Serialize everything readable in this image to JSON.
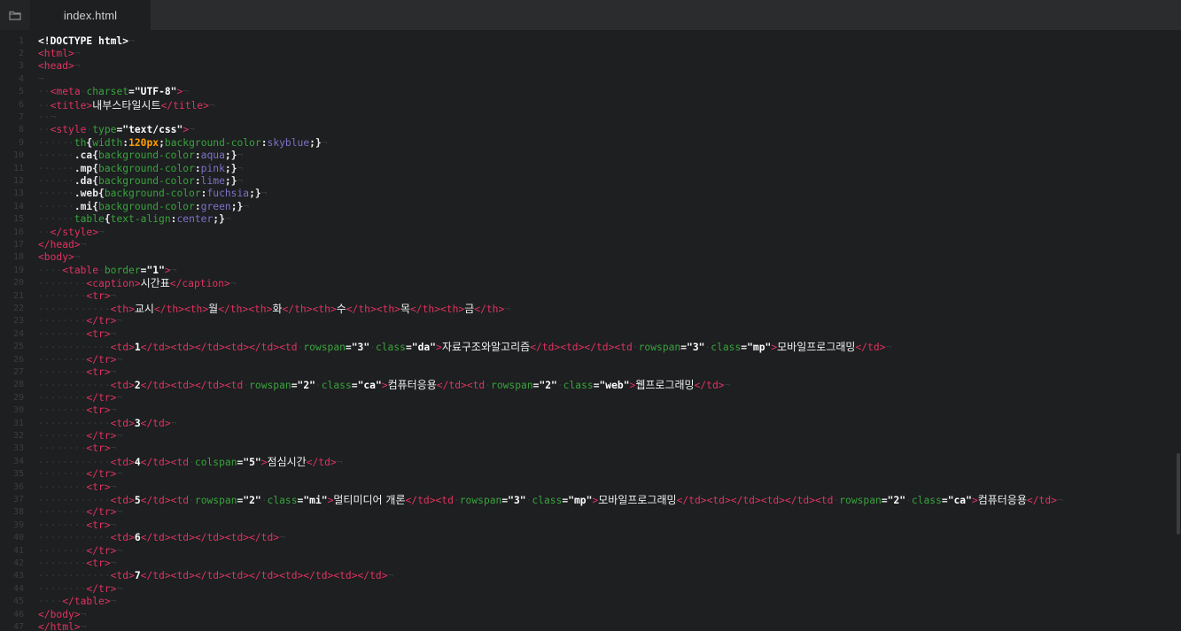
{
  "sidebar": {
    "toggle_icon": "folder-icon"
  },
  "tab": {
    "label": "index.html"
  },
  "lines": [
    {
      "n": "1",
      "segs": [
        [
          "d",
          "<!DOCTYPE html>"
        ],
        [
          "w",
          "¬"
        ]
      ]
    },
    {
      "n": "2",
      "segs": [
        [
          "t",
          "<html>"
        ],
        [
          "w",
          "¬"
        ]
      ]
    },
    {
      "n": "3",
      "segs": [
        [
          "t",
          "<head>"
        ],
        [
          "w",
          "¬"
        ]
      ]
    },
    {
      "n": "4",
      "segs": [
        [
          "w",
          "¬"
        ]
      ]
    },
    {
      "n": "5",
      "segs": [
        [
          "w",
          "··"
        ],
        [
          "t",
          "<meta"
        ],
        [
          "w",
          "·"
        ],
        [
          "a",
          "charset"
        ],
        [
          "p",
          "="
        ],
        [
          "s",
          "\"UTF-8\""
        ],
        [
          "t",
          ">"
        ],
        [
          "w",
          "¬"
        ]
      ]
    },
    {
      "n": "6",
      "segs": [
        [
          "w",
          "··"
        ],
        [
          "t",
          "<title>"
        ],
        [
          "k",
          "내부스타일시트"
        ],
        [
          "t",
          "</title>"
        ],
        [
          "w",
          "¬"
        ]
      ]
    },
    {
      "n": "7",
      "segs": [
        [
          "w",
          "··¬"
        ]
      ]
    },
    {
      "n": "8",
      "segs": [
        [
          "w",
          "··"
        ],
        [
          "t",
          "<style"
        ],
        [
          "w",
          "·"
        ],
        [
          "a",
          "type"
        ],
        [
          "p",
          "="
        ],
        [
          "s",
          "\"text/css\""
        ],
        [
          "t",
          ">"
        ],
        [
          "w",
          "¬"
        ]
      ]
    },
    {
      "n": "9",
      "segs": [
        [
          "w",
          "······"
        ],
        [
          "a",
          "th"
        ],
        [
          "p",
          "{"
        ],
        [
          "a",
          "width"
        ],
        [
          "p",
          ":"
        ],
        [
          "n",
          "120px"
        ],
        [
          "p",
          ";"
        ],
        [
          "a",
          "background-color"
        ],
        [
          "p",
          ":"
        ],
        [
          "v",
          "skyblue"
        ],
        [
          "p",
          ";}"
        ],
        [
          "w",
          "¬"
        ]
      ]
    },
    {
      "n": "10",
      "segs": [
        [
          "w",
          "······"
        ],
        [
          "p",
          ".ca{"
        ],
        [
          "a",
          "background-color"
        ],
        [
          "p",
          ":"
        ],
        [
          "v",
          "aqua"
        ],
        [
          "p",
          ";}"
        ],
        [
          "w",
          "¬"
        ]
      ]
    },
    {
      "n": "11",
      "segs": [
        [
          "w",
          "······"
        ],
        [
          "p",
          ".mp{"
        ],
        [
          "a",
          "background-color"
        ],
        [
          "p",
          ":"
        ],
        [
          "v",
          "pink"
        ],
        [
          "p",
          ";}"
        ],
        [
          "w",
          "¬"
        ]
      ]
    },
    {
      "n": "12",
      "segs": [
        [
          "w",
          "······"
        ],
        [
          "p",
          ".da{"
        ],
        [
          "a",
          "background-color"
        ],
        [
          "p",
          ":"
        ],
        [
          "v",
          "lime"
        ],
        [
          "p",
          ";}"
        ],
        [
          "w",
          "¬"
        ]
      ]
    },
    {
      "n": "13",
      "segs": [
        [
          "w",
          "······"
        ],
        [
          "p",
          ".web{"
        ],
        [
          "a",
          "background-color"
        ],
        [
          "p",
          ":"
        ],
        [
          "v",
          "fuchsia"
        ],
        [
          "p",
          ";}"
        ],
        [
          "w",
          "¬"
        ]
      ]
    },
    {
      "n": "14",
      "segs": [
        [
          "w",
          "······"
        ],
        [
          "p",
          ".mi{"
        ],
        [
          "a",
          "background-color"
        ],
        [
          "p",
          ":"
        ],
        [
          "v",
          "green"
        ],
        [
          "p",
          ";}"
        ],
        [
          "w",
          "¬"
        ]
      ]
    },
    {
      "n": "15",
      "segs": [
        [
          "w",
          "······"
        ],
        [
          "a",
          "table"
        ],
        [
          "p",
          "{"
        ],
        [
          "a",
          "text-align"
        ],
        [
          "p",
          ":"
        ],
        [
          "v",
          "center"
        ],
        [
          "p",
          ";}"
        ],
        [
          "w",
          "¬"
        ]
      ]
    },
    {
      "n": "16",
      "segs": [
        [
          "w",
          "··"
        ],
        [
          "t",
          "</style>"
        ],
        [
          "w",
          "¬"
        ]
      ]
    },
    {
      "n": "17",
      "segs": [
        [
          "t",
          "</head>"
        ],
        [
          "w",
          "¬"
        ]
      ]
    },
    {
      "n": "18",
      "segs": [
        [
          "t",
          "<body>"
        ],
        [
          "w",
          "¬"
        ]
      ]
    },
    {
      "n": "19",
      "segs": [
        [
          "w",
          "····"
        ],
        [
          "t",
          "<table"
        ],
        [
          "w",
          "·"
        ],
        [
          "a",
          "border"
        ],
        [
          "p",
          "="
        ],
        [
          "s",
          "\"1\""
        ],
        [
          "t",
          ">"
        ],
        [
          "w",
          "¬"
        ]
      ]
    },
    {
      "n": "20",
      "segs": [
        [
          "w",
          "········"
        ],
        [
          "t",
          "<caption>"
        ],
        [
          "k",
          "시간표"
        ],
        [
          "t",
          "</caption>"
        ],
        [
          "w",
          "¬"
        ]
      ]
    },
    {
      "n": "21",
      "segs": [
        [
          "w",
          "········"
        ],
        [
          "t",
          "<tr>"
        ],
        [
          "w",
          "¬"
        ]
      ]
    },
    {
      "n": "22",
      "segs": [
        [
          "w",
          "············"
        ],
        [
          "t",
          "<th>"
        ],
        [
          "k",
          "교시"
        ],
        [
          "t",
          "</th><th>"
        ],
        [
          "k",
          "월"
        ],
        [
          "t",
          "</th><th>"
        ],
        [
          "k",
          "화"
        ],
        [
          "t",
          "</th><th>"
        ],
        [
          "k",
          "수"
        ],
        [
          "t",
          "</th><th>"
        ],
        [
          "k",
          "목"
        ],
        [
          "t",
          "</th><th>"
        ],
        [
          "k",
          "금"
        ],
        [
          "t",
          "</th>"
        ],
        [
          "w",
          "¬"
        ]
      ]
    },
    {
      "n": "23",
      "segs": [
        [
          "w",
          "········"
        ],
        [
          "t",
          "</tr>"
        ],
        [
          "w",
          "¬"
        ]
      ]
    },
    {
      "n": "24",
      "segs": [
        [
          "w",
          "········"
        ],
        [
          "t",
          "<tr>"
        ],
        [
          "w",
          "¬"
        ]
      ]
    },
    {
      "n": "25",
      "segs": [
        [
          "w",
          "············"
        ],
        [
          "t",
          "<td>"
        ],
        [
          "d",
          "1"
        ],
        [
          "t",
          "</td><td></td><td></td><td"
        ],
        [
          "w",
          "·"
        ],
        [
          "a",
          "rowspan"
        ],
        [
          "p",
          "="
        ],
        [
          "s",
          "\"3\""
        ],
        [
          "w",
          "·"
        ],
        [
          "a",
          "class"
        ],
        [
          "p",
          "="
        ],
        [
          "s",
          "\"da\""
        ],
        [
          "t",
          ">"
        ],
        [
          "k",
          "자료구조와알고리즘"
        ],
        [
          "t",
          "</td><td></td><td"
        ],
        [
          "w",
          "·"
        ],
        [
          "a",
          "rowspan"
        ],
        [
          "p",
          "="
        ],
        [
          "s",
          "\"3\""
        ],
        [
          "w",
          "·"
        ],
        [
          "a",
          "class"
        ],
        [
          "p",
          "="
        ],
        [
          "s",
          "\"mp\""
        ],
        [
          "t",
          ">"
        ],
        [
          "k",
          "모바일프로그래밍"
        ],
        [
          "t",
          "</td>"
        ],
        [
          "w",
          "¬"
        ]
      ]
    },
    {
      "n": "26",
      "segs": [
        [
          "w",
          "········"
        ],
        [
          "t",
          "</tr>"
        ],
        [
          "w",
          "¬"
        ]
      ]
    },
    {
      "n": "27",
      "segs": [
        [
          "w",
          "········"
        ],
        [
          "t",
          "<tr>"
        ],
        [
          "w",
          "¬"
        ]
      ]
    },
    {
      "n": "28",
      "segs": [
        [
          "w",
          "············"
        ],
        [
          "t",
          "<td>"
        ],
        [
          "d",
          "2"
        ],
        [
          "t",
          "</td><td></td><td"
        ],
        [
          "w",
          "·"
        ],
        [
          "a",
          "rowspan"
        ],
        [
          "p",
          "="
        ],
        [
          "s",
          "\"2\""
        ],
        [
          "w",
          "·"
        ],
        [
          "a",
          "class"
        ],
        [
          "p",
          "="
        ],
        [
          "s",
          "\"ca\""
        ],
        [
          "t",
          ">"
        ],
        [
          "k",
          "컴퓨터응용"
        ],
        [
          "t",
          "</td><td"
        ],
        [
          "w",
          "·"
        ],
        [
          "a",
          "rowspan"
        ],
        [
          "p",
          "="
        ],
        [
          "s",
          "\"2\""
        ],
        [
          "w",
          "·"
        ],
        [
          "a",
          "class"
        ],
        [
          "p",
          "="
        ],
        [
          "s",
          "\"web\""
        ],
        [
          "t",
          ">"
        ],
        [
          "k",
          "웹프로그래밍"
        ],
        [
          "t",
          "</td>"
        ],
        [
          "w",
          "¬"
        ]
      ]
    },
    {
      "n": "29",
      "segs": [
        [
          "w",
          "········"
        ],
        [
          "t",
          "</tr>"
        ],
        [
          "w",
          "¬"
        ]
      ]
    },
    {
      "n": "30",
      "segs": [
        [
          "w",
          "········"
        ],
        [
          "t",
          "<tr>"
        ],
        [
          "w",
          "¬"
        ]
      ]
    },
    {
      "n": "31",
      "segs": [
        [
          "w",
          "············"
        ],
        [
          "t",
          "<td>"
        ],
        [
          "d",
          "3"
        ],
        [
          "t",
          "</td>"
        ],
        [
          "w",
          "¬"
        ]
      ]
    },
    {
      "n": "32",
      "segs": [
        [
          "w",
          "········"
        ],
        [
          "t",
          "</tr>"
        ],
        [
          "w",
          "¬"
        ]
      ]
    },
    {
      "n": "33",
      "segs": [
        [
          "w",
          "········"
        ],
        [
          "t",
          "<tr>"
        ],
        [
          "w",
          "¬"
        ]
      ]
    },
    {
      "n": "34",
      "segs": [
        [
          "w",
          "············"
        ],
        [
          "t",
          "<td>"
        ],
        [
          "d",
          "4"
        ],
        [
          "t",
          "</td><td"
        ],
        [
          "w",
          "·"
        ],
        [
          "a",
          "colspan"
        ],
        [
          "p",
          "="
        ],
        [
          "s",
          "\"5\""
        ],
        [
          "t",
          ">"
        ],
        [
          "k",
          "점심시간"
        ],
        [
          "t",
          "</td>"
        ],
        [
          "w",
          "¬"
        ]
      ]
    },
    {
      "n": "35",
      "segs": [
        [
          "w",
          "········"
        ],
        [
          "t",
          "</tr>"
        ],
        [
          "w",
          "¬"
        ]
      ]
    },
    {
      "n": "36",
      "segs": [
        [
          "w",
          "········"
        ],
        [
          "t",
          "<tr>"
        ],
        [
          "w",
          "¬"
        ]
      ]
    },
    {
      "n": "37",
      "segs": [
        [
          "w",
          "············"
        ],
        [
          "t",
          "<td>"
        ],
        [
          "d",
          "5"
        ],
        [
          "t",
          "</td><td"
        ],
        [
          "w",
          "·"
        ],
        [
          "a",
          "rowspan"
        ],
        [
          "p",
          "="
        ],
        [
          "s",
          "\"2\""
        ],
        [
          "w",
          "·"
        ],
        [
          "a",
          "class"
        ],
        [
          "p",
          "="
        ],
        [
          "s",
          "\"mi\""
        ],
        [
          "t",
          ">"
        ],
        [
          "k",
          "멀티미디어 개론"
        ],
        [
          "t",
          "</td><td"
        ],
        [
          "w",
          "·"
        ],
        [
          "a",
          "rowspan"
        ],
        [
          "p",
          "="
        ],
        [
          "s",
          "\"3\""
        ],
        [
          "w",
          "·"
        ],
        [
          "a",
          "class"
        ],
        [
          "p",
          "="
        ],
        [
          "s",
          "\"mp\""
        ],
        [
          "t",
          ">"
        ],
        [
          "k",
          "모바일프로그래밍"
        ],
        [
          "t",
          "</td><td></td><td></td><td"
        ],
        [
          "w",
          "·"
        ],
        [
          "a",
          "rowspan"
        ],
        [
          "p",
          "="
        ],
        [
          "s",
          "\"2\""
        ],
        [
          "w",
          "·"
        ],
        [
          "a",
          "class"
        ],
        [
          "p",
          "="
        ],
        [
          "s",
          "\"ca\""
        ],
        [
          "t",
          ">"
        ],
        [
          "k",
          "컴퓨터응용"
        ],
        [
          "t",
          "</td>"
        ],
        [
          "w",
          "¬"
        ]
      ]
    },
    {
      "n": "38",
      "segs": [
        [
          "w",
          "········"
        ],
        [
          "t",
          "</tr>"
        ],
        [
          "w",
          "¬"
        ]
      ]
    },
    {
      "n": "39",
      "segs": [
        [
          "w",
          "········"
        ],
        [
          "t",
          "<tr>"
        ],
        [
          "w",
          "¬"
        ]
      ]
    },
    {
      "n": "40",
      "segs": [
        [
          "w",
          "············"
        ],
        [
          "t",
          "<td>"
        ],
        [
          "d",
          "6"
        ],
        [
          "t",
          "</td><td></td><td></td>"
        ],
        [
          "w",
          "¬"
        ]
      ]
    },
    {
      "n": "41",
      "segs": [
        [
          "w",
          "········"
        ],
        [
          "t",
          "</tr>"
        ],
        [
          "w",
          "¬"
        ]
      ]
    },
    {
      "n": "42",
      "segs": [
        [
          "w",
          "········"
        ],
        [
          "t",
          "<tr>"
        ],
        [
          "w",
          "¬"
        ]
      ]
    },
    {
      "n": "43",
      "segs": [
        [
          "w",
          "············"
        ],
        [
          "t",
          "<td>"
        ],
        [
          "d",
          "7"
        ],
        [
          "t",
          "</td><td></td><td></td><td></td><td></td>"
        ],
        [
          "w",
          "¬"
        ]
      ]
    },
    {
      "n": "44",
      "segs": [
        [
          "w",
          "········"
        ],
        [
          "t",
          "</tr>"
        ],
        [
          "w",
          "¬"
        ]
      ]
    },
    {
      "n": "45",
      "segs": [
        [
          "w",
          "····"
        ],
        [
          "t",
          "</table>"
        ],
        [
          "w",
          "¬"
        ]
      ]
    },
    {
      "n": "46",
      "segs": [
        [
          "t",
          "</body>"
        ],
        [
          "w",
          "¬"
        ]
      ]
    },
    {
      "n": "47",
      "segs": [
        [
          "t",
          "</html>"
        ],
        [
          "w",
          "¬"
        ]
      ]
    }
  ]
}
